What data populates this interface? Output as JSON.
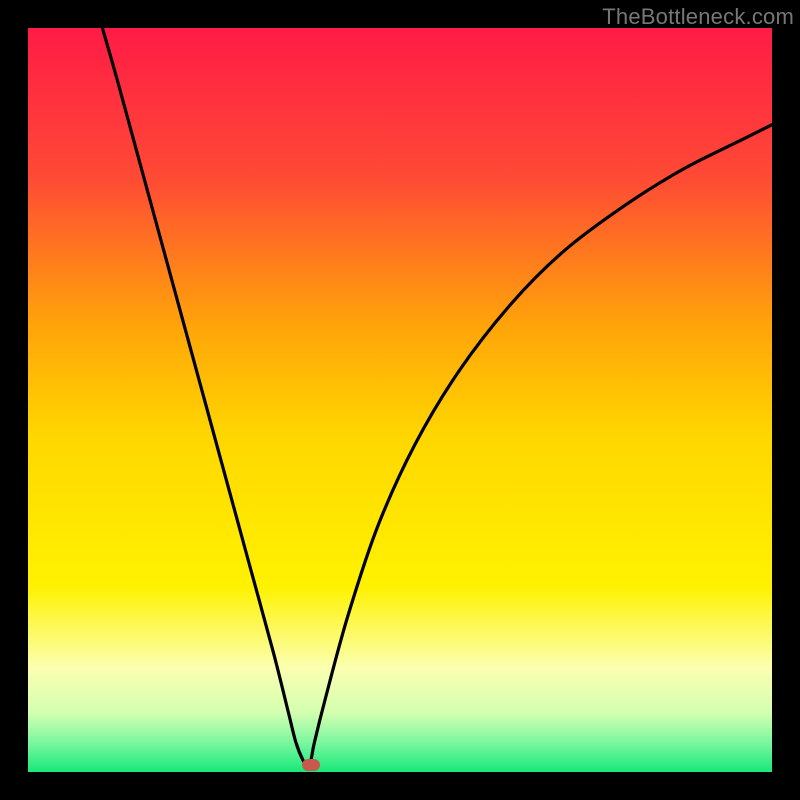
{
  "watermark": "TheBottleneck.com",
  "chart_data": {
    "type": "line",
    "title": "",
    "xlabel": "",
    "ylabel": "",
    "xlim": [
      0,
      100
    ],
    "ylim": [
      0,
      100
    ],
    "grid": false,
    "series": [
      {
        "name": "curve",
        "x": [
          10,
          12,
          15,
          18,
          21,
          24,
          27,
          30,
          33,
          35,
          36,
          37,
          37.5,
          38,
          38.5,
          40,
          43,
          47,
          52,
          58,
          65,
          72,
          80,
          88,
          96,
          100
        ],
        "y": [
          100,
          93,
          82,
          71,
          60,
          49,
          38,
          27,
          16,
          8,
          4,
          1.5,
          1,
          1.5,
          4,
          10,
          21,
          33,
          44,
          54,
          63,
          70,
          76,
          81,
          85,
          87
        ]
      }
    ],
    "marker": {
      "x": 38,
      "y": 1
    },
    "background_gradient": {
      "stops": [
        {
          "offset": 0.0,
          "color": "#ff1b46"
        },
        {
          "offset": 0.2,
          "color": "#ff4a35"
        },
        {
          "offset": 0.4,
          "color": "#ffa409"
        },
        {
          "offset": 0.55,
          "color": "#ffd700"
        },
        {
          "offset": 0.75,
          "color": "#fff200"
        },
        {
          "offset": 0.86,
          "color": "#fbffb0"
        },
        {
          "offset": 0.92,
          "color": "#d4ffb0"
        },
        {
          "offset": 0.96,
          "color": "#7cf7a0"
        },
        {
          "offset": 1.0,
          "color": "#17e879"
        }
      ]
    }
  }
}
